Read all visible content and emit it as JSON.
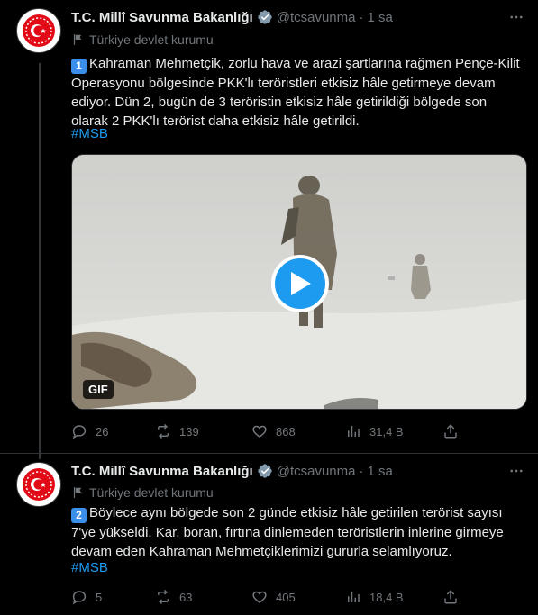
{
  "account": {
    "name": "T.C. Millî Savunma Bakanlığı",
    "handle": "@tcsavunma",
    "affiliation": "Türkiye devlet kurumu"
  },
  "tweets": [
    {
      "time": "1 sa",
      "number": "1",
      "text": "Kahraman Mehmetçik, zorlu hava ve arazi şartlarına rağmen Pençe-Kilit Operasyonu bölgesinde PKK'lı teröristleri etkisiz hâle getirmeye devam ediyor. Dün 2, bugün de 3 teröristin etkisiz hâle getirildiği bölgede son olarak 2 PKK'lı terörist daha etkisiz hâle getirildi.",
      "hashtag": "#MSB",
      "media_badge": "GIF",
      "replies": "26",
      "retweets": "139",
      "likes": "868",
      "views": "31,4 B"
    },
    {
      "time": "1 sa",
      "number": "2",
      "text": "Böylece aynı bölgede son 2 günde etkisiz hâle getirilen terörist sayısı 7'ye yükseldi. Kar, boran, fırtına dinlemeden teröristlerin inlerine girmeye devam eden Kahraman Mehmetçiklerimizi gururla selamlıyoruz.",
      "hashtag": "#MSB",
      "replies": "5",
      "retweets": "63",
      "likes": "405",
      "views": "18,4 B"
    }
  ],
  "colors": {
    "background": "#000000",
    "text": "#e7e9ea",
    "muted": "#71767b",
    "link": "#1d9bf0",
    "verified": "#829aab"
  },
  "icons": [
    "avatar-emblem",
    "verified-badge-icon",
    "more-icon",
    "flag-icon",
    "reply-icon",
    "retweet-icon",
    "like-icon",
    "views-icon",
    "share-icon",
    "play-icon"
  ]
}
